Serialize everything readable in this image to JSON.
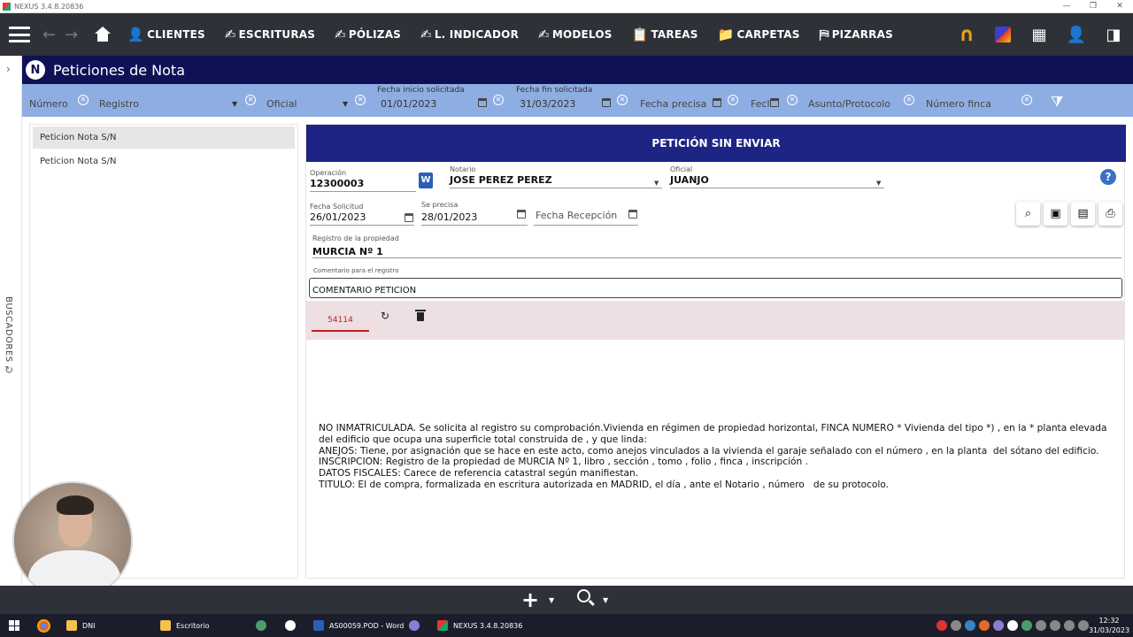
{
  "window": {
    "title": "NEXUS  3.4.8.20836"
  },
  "topnav": {
    "items": [
      {
        "label": "CLIENTES"
      },
      {
        "label": "ESCRITURAS"
      },
      {
        "label": "PÓLIZAS"
      },
      {
        "label": "L. INDICADOR"
      },
      {
        "label": "MODELOS"
      },
      {
        "label": "TAREAS"
      },
      {
        "label": "CARPETAS"
      },
      {
        "label": "PIZARRAS"
      }
    ]
  },
  "header": {
    "badge": "N",
    "title": "Peticiones de Nota"
  },
  "sidebar": {
    "collapsed_label": "BUSCADORES"
  },
  "filters": {
    "numero": {
      "placeholder": "Número"
    },
    "registro": {
      "placeholder": "Registro"
    },
    "oficial": {
      "placeholder": "Oficial"
    },
    "fecha_inicio": {
      "label": "Fecha inicio solicitada",
      "value": "01/01/2023"
    },
    "fecha_fin": {
      "label": "Fecha fin solicitada",
      "value": "31/03/2023"
    },
    "fecha_precisa": {
      "placeholder": "Fecha precisa"
    },
    "fecha_short": {
      "placeholder": "Fecl"
    },
    "asunto": {
      "placeholder": "Asunto/Protocolo"
    },
    "numero_finca": {
      "placeholder": "Número finca"
    }
  },
  "list": {
    "items": [
      {
        "label": "Peticion Nota S/N"
      },
      {
        "label": "Peticion Nota S/N"
      }
    ]
  },
  "detail": {
    "status_title": "PETICIÓN SIN ENVIAR",
    "operacion": {
      "label": "Operación",
      "value": "12300003"
    },
    "notario": {
      "label": "Notario",
      "value": "JOSE PEREZ PEREZ"
    },
    "oficial": {
      "label": "Oficial",
      "value": "JUANJO"
    },
    "fecha_solicitud": {
      "label": "Fecha Solicitud",
      "value": "26/01/2023"
    },
    "se_precisa": {
      "label": "Se precisa",
      "value": "28/01/2023"
    },
    "fecha_recepcion": {
      "placeholder": "Fecha Recepción"
    },
    "registro": {
      "label": "Registro de la propiedad",
      "value": "MURCIA Nº 1"
    },
    "comentario": {
      "label": "Comentario para el registro",
      "value": "COMENTARIO PETICION"
    },
    "tab": {
      "label": "54114"
    },
    "note_lines": [
      "NO INMATRICULADA. Se solicita al registro su comprobación.Vivienda en régimen de propiedad horizontal, FINCA NUMERO * Vivienda del tipo *) , en la * planta elevada del edificio que ocupa una superficie total construida de , y que linda:",
      "ANEJOS: Tiene, por asignación que se hace en este acto, como anejos vinculados a la vivienda el garaje señalado con el número , en la planta  del sótano del edificio.",
      "INSCRIPCION: Registro de la propiedad de MURCIA Nº 1, libro , sección , tomo , folio , finca , inscripción .",
      "DATOS FISCALES: Carece de referencia catastral según manifiestan.",
      "TITULO: El de compra, formalizada en escritura autorizada en MADRID, el día , ante el Notario , número   de su protocolo."
    ]
  },
  "taskbar": {
    "items": [
      {
        "label": "DNI"
      },
      {
        "label": "Escritorio"
      },
      {
        "label": "AS00059.POD - Word"
      },
      {
        "label": "NEXUS  3.4.8.20836"
      }
    ],
    "time": "12:32",
    "date": "31/03/2023"
  },
  "colors": {
    "nav_bg": "#2e3238",
    "header_bg": "#0e1156",
    "filter_bg": "#8eaee3",
    "status_bg": "#1e2484",
    "tab_accent": "#c21d1d"
  }
}
